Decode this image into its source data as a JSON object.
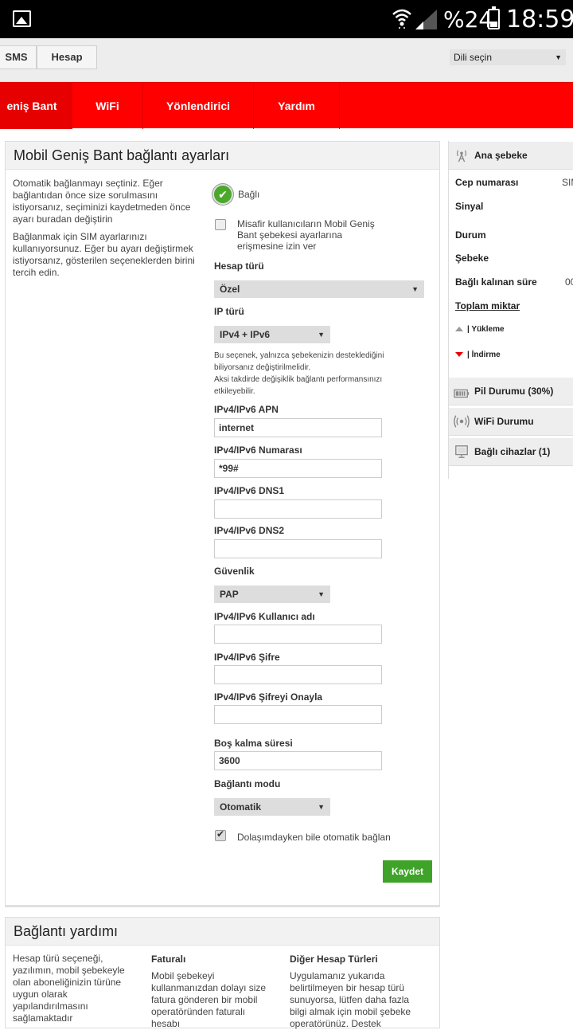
{
  "status_bar": {
    "battery": "%24",
    "time": "18:59"
  },
  "top_tabs": [
    "SMS",
    "Hesap"
  ],
  "language_select": "Dili seçin",
  "nav": [
    "eniş Bant",
    "WiFi",
    "Yönlendirici",
    "Yardım"
  ],
  "main": {
    "title": "Mobil Geniş Bant bağlantı ayarları",
    "desc1": [
      "Otomatik bağlanmayı seçtiniz. Eğer",
      "bağlantıdan önce size sorulmasını",
      "istiyorsanız, seçiminizi kaydetmeden önce",
      "ayarı buradan değiştirin"
    ],
    "desc2": [
      "Bağlanmak için SIM ayarlarınızı",
      "kullanıyorsunuz. Eğer bu ayarı değiştirmek",
      "istiyorsanız, gösterilen seçeneklerden birini",
      "tercih edin."
    ],
    "connected_label": "Bağlı",
    "guest_checkbox_text": [
      "Misafir kullanıcıların Mobil Geniş",
      "Bant şebekesi ayarlarına",
      "erişmesine izin ver"
    ],
    "account_type_label": "Hesap türü",
    "account_type_value": "Özel",
    "ip_type_label": "IP türü",
    "ip_type_value": "IPv4 + IPv6",
    "note": [
      "Bu seçenek, yalnızca şebekenizin desteklediğini",
      "biliyorsanız değiştirilmelidir.",
      "Aksi takdirde değişiklik bağlantı performansınızı",
      "etkileyebilir."
    ],
    "apn_label": "IPv4/IPv6 APN",
    "apn_value": "internet",
    "number_label": "IPv4/IPv6 Numarası",
    "number_value": "*99#",
    "dns1_label": "IPv4/IPv6 DNS1",
    "dns1_value": "",
    "dns2_label": "IPv4/IPv6 DNS2",
    "dns2_value": "",
    "security_label": "Güvenlik",
    "security_value": "PAP",
    "username_label": "IPv4/IPv6 Kullanıcı adı",
    "username_value": "",
    "password_label": "IPv4/IPv6 Şifre",
    "password_value": "",
    "password_confirm_label": "IPv4/IPv6 Şifreyi Onayla",
    "password_confirm_value": "",
    "idle_label": "Boş kalma süresi",
    "idle_value": "3600",
    "mode_label": "Bağlantı modu",
    "mode_value": "Otomatik",
    "roaming_checkbox_text": "Dolaşımdayken bile otomatik bağlan",
    "save_label": "Kaydet"
  },
  "help": {
    "title": "Bağlantı yardımı",
    "col1": {
      "heading": "",
      "lines": [
        "Hesap türü seçeneği,",
        "yazılımın, mobil şebekeyle",
        "olan aboneliğinizin türüne",
        "uygun olarak",
        "yapılandırılmasını",
        "sağlamaktadır"
      ]
    },
    "col2": {
      "heading": "Faturalı",
      "lines": [
        "Mobil şebekeyi",
        "kullanmanızdan dolayı size",
        "fatura gönderen bir mobil",
        "operatöründen faturalı",
        "hesabı"
      ]
    },
    "col3": {
      "heading": "Diğer Hesap Türleri",
      "lines": [
        "Uygulamanız yukarıda",
        "belirtilmeyen bir hesap türü",
        "sunuyorsa, lütfen daha fazla",
        "bilgi almak için mobil şebeke",
        "operatörünüz. Destek"
      ]
    }
  },
  "sidebar": {
    "network_header": "Ana şebeke",
    "phone_label": "Cep numarası",
    "phone_value": "SIM",
    "signal_label": "Sinyal",
    "status_label": "Durum",
    "network_label": "Şebeke",
    "duration_label": "Bağlı kalınan süre",
    "duration_value": "00",
    "total_label": "Toplam miktar",
    "upload_label": "Yükleme",
    "download_label": "İndirme",
    "battery_header": "Pil Durumu (30%)",
    "wifi_header": "WiFi Durumu",
    "devices_header": "Bağlı cihazlar (1)"
  }
}
